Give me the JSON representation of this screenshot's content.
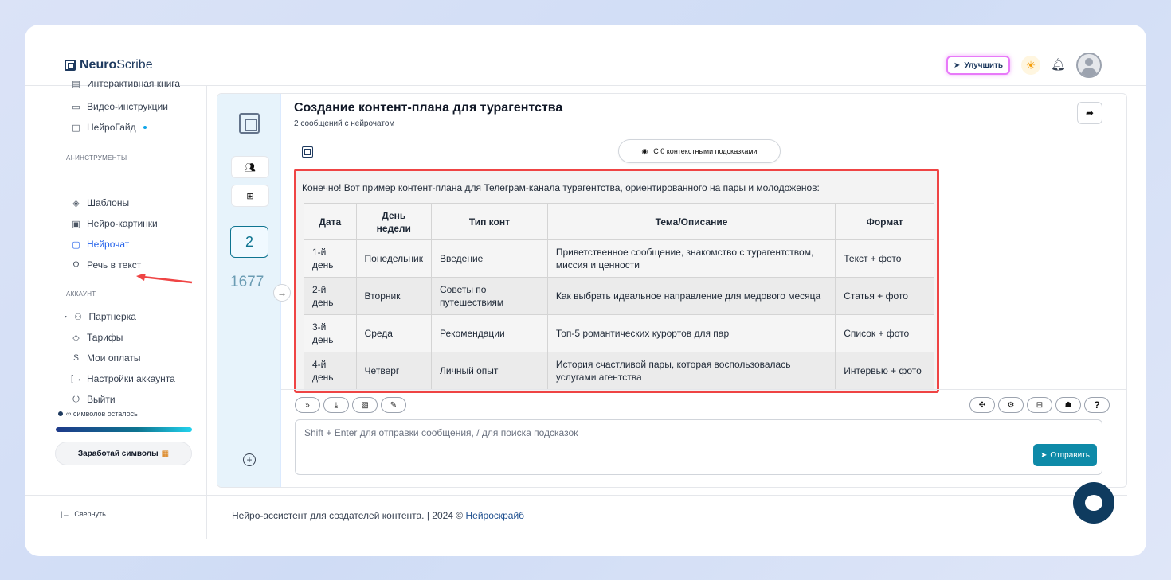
{
  "header": {
    "logo_bold": "Neuro",
    "logo_rest": "Scribe",
    "upgrade_label": "Улучшить"
  },
  "sidebar": {
    "items_top": [
      {
        "label": "Интерактивная книга",
        "icon": "book-icon"
      },
      {
        "label": "Видео-инструкции",
        "icon": "video-icon"
      },
      {
        "label": "НейроГайд",
        "icon": "guide-icon"
      }
    ],
    "section_ai": "AI-ИНСТРУМЕНТЫ",
    "items_ai": [
      {
        "label": "Шаблоны",
        "icon": "layers-icon"
      },
      {
        "label": "Нейро-картинки",
        "icon": "image-icon"
      },
      {
        "label": "Нейрочат",
        "icon": "chat-icon"
      },
      {
        "label": "Речь в текст",
        "icon": "headphones-icon"
      }
    ],
    "section_account": "АККАУНТ",
    "items_account": [
      {
        "label": "Партнерка",
        "icon": "users-icon"
      },
      {
        "label": "Тарифы",
        "icon": "tag-icon"
      },
      {
        "label": "Мои оплаты",
        "icon": "dollar-icon"
      },
      {
        "label": "Настройки аккаунта",
        "icon": "login-icon"
      },
      {
        "label": "Выйти",
        "icon": "power-icon"
      }
    ],
    "chars_left": "∞ символов осталось",
    "earn_label": "Заработай символы",
    "collapse_label": "Свернуть"
  },
  "rail": {
    "selected_number": "2",
    "count": "1677"
  },
  "chat": {
    "title": "Создание контент-плана для турагентства",
    "subtitle": "2 сообщений с нейрочатом",
    "context_hints": "С 0 контекстными подсказками",
    "intro": "Конечно! Вот пример контент-плана для Телеграм-канала турагентства, ориентированного на пары и молодоженов:",
    "table": {
      "headers": [
        "Дата",
        "День недели",
        "Тип конт",
        "Тема/Описание",
        "Формат"
      ],
      "rows": [
        [
          "1-й день",
          "Понедельник",
          "Введение",
          "Приветственное сообщение, знакомство с турагентством, миссия и ценности",
          "Текст + фото"
        ],
        [
          "2-й день",
          "Вторник",
          "Советы по путешествиям",
          "Как выбрать идеальное направление для медового месяца",
          "Статья + фото"
        ],
        [
          "3-й день",
          "Среда",
          "Рекомендации",
          "Топ-5 романтических курортов для пар",
          "Список + фото"
        ],
        [
          "4-й день",
          "Четверг",
          "Личный опыт",
          "История счастливой пары, которая воспользовалась услугами агентства",
          "Интервью + фото"
        ]
      ]
    },
    "input_placeholder": "Shift + Enter для отправки сообщения, / для поиска подсказок",
    "send_label": "Отправить"
  },
  "footer": {
    "text": "Нейро-ассистент для создателей контента.  | 2024 © ",
    "link": "Нейроскрайб"
  },
  "colors": {
    "accent": "#0e8aa8",
    "highlight": "#ef4444",
    "active_nav": "#2563eb"
  }
}
